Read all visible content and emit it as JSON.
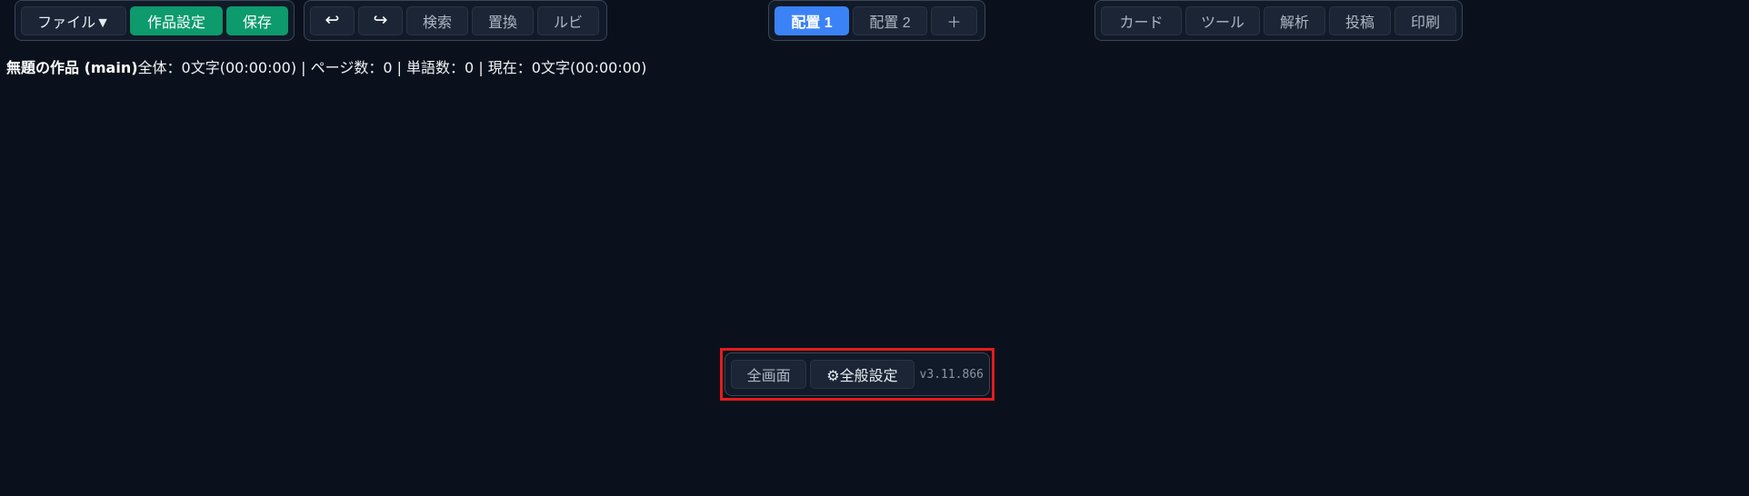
{
  "toolbar": {
    "file_menu": "ファイル▼",
    "work_settings": "作品設定",
    "save": "保存",
    "undo_icon": "↩",
    "redo_icon": "↪",
    "search": "検索",
    "replace": "置換",
    "ruby": "ルビ",
    "layouts": [
      "配置 1",
      "配置 2"
    ],
    "add_layout": "＋",
    "tools": [
      "カード",
      "ツール",
      "解析",
      "投稿",
      "印刷"
    ]
  },
  "status": {
    "title": "無題の作品 (main)",
    "summary": "全体：0文字(00:00:00) | ページ数：0 | 単語数：0 | 現在：0文字(00:00:00)"
  },
  "footer": {
    "fullscreen": "全画面",
    "general_settings": "⚙全般設定",
    "version": "v3.11.866"
  },
  "colors": {
    "background": "#0b111c",
    "accent_green": "#0d9a6c",
    "accent_blue": "#3b82f6",
    "highlight_red": "#e31c1c"
  }
}
